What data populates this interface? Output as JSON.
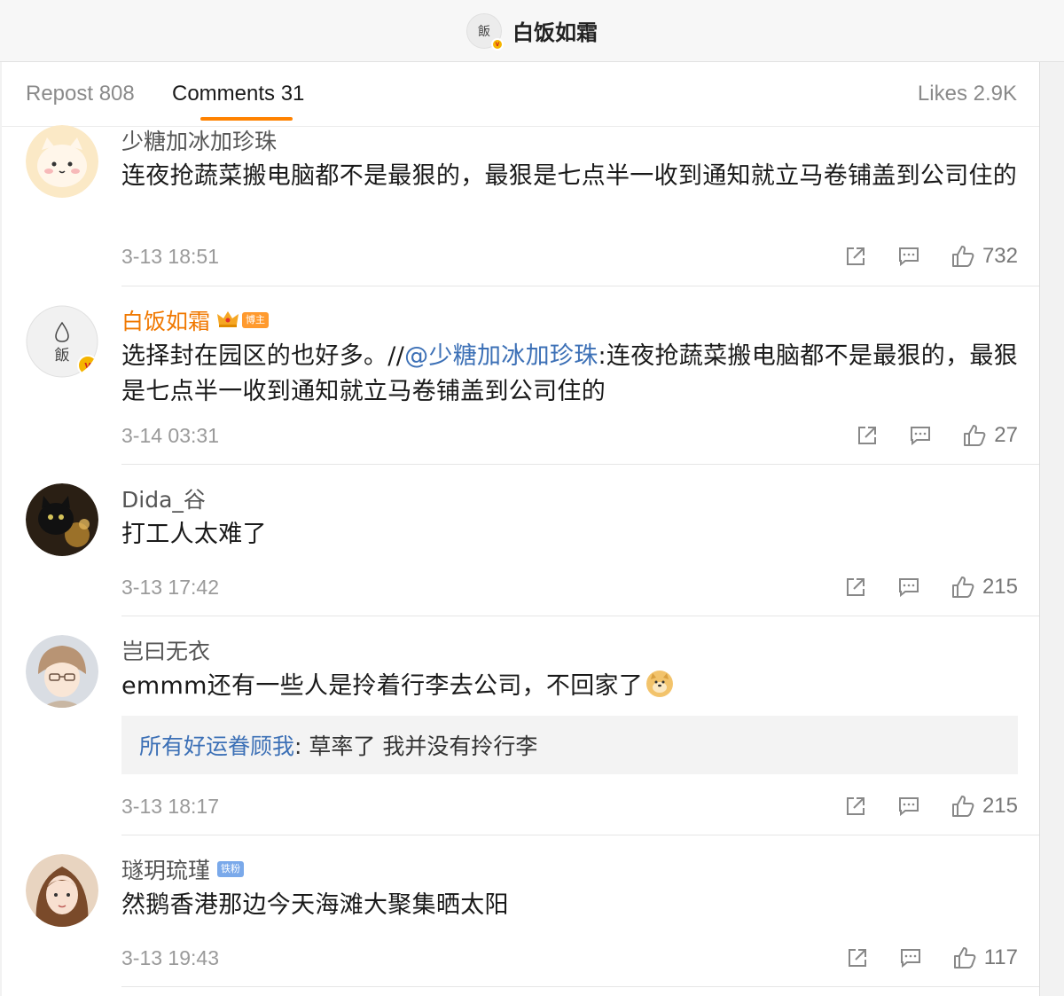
{
  "header": {
    "title": "白饭如霜",
    "avatar_glyph": "飯"
  },
  "tabs": {
    "repost": "Repost 808",
    "comments": "Comments 31",
    "likes": "Likes 2.9K"
  },
  "comments": [
    {
      "user": "少糖加冰加珍珠",
      "text": "连夜抢蔬菜搬电脑都不是最狠的，最狠是七点半一收到通知就立马卷铺盖到公司住的",
      "time": "3-13 18:51",
      "likes": "732"
    },
    {
      "user": "白饭如霜",
      "badge": "博主",
      "text_prefix": "选择封在园区的也好多。//",
      "mention": "@少糖加冰加珍珠",
      "text_suffix": ":连夜抢蔬菜搬电脑都不是最狠的，最狠是七点半一收到通知就立马卷铺盖到公司住的",
      "time": "3-14 03:31",
      "likes": "27"
    },
    {
      "user": "Dida_谷",
      "text": "打工人太难了",
      "time": "3-13 17:42",
      "likes": "215"
    },
    {
      "user": "岂曰无衣",
      "text": "emmm还有一些人是拎着行李去公司，不回家了",
      "reply_user": "所有好运眷顾我",
      "reply_text": ": 草率了 我并没有拎行李",
      "time": "3-13 18:17",
      "likes": "215"
    },
    {
      "user": "璲玥琉瑾",
      "badge": "铁粉",
      "text": "然鹅香港那边今天海滩大聚集晒太阳",
      "time": "3-13 19:43",
      "likes": "117"
    }
  ],
  "colors": {
    "accent": "#ff8200",
    "mention": "#3c70b6",
    "owner_name": "#f07800"
  }
}
